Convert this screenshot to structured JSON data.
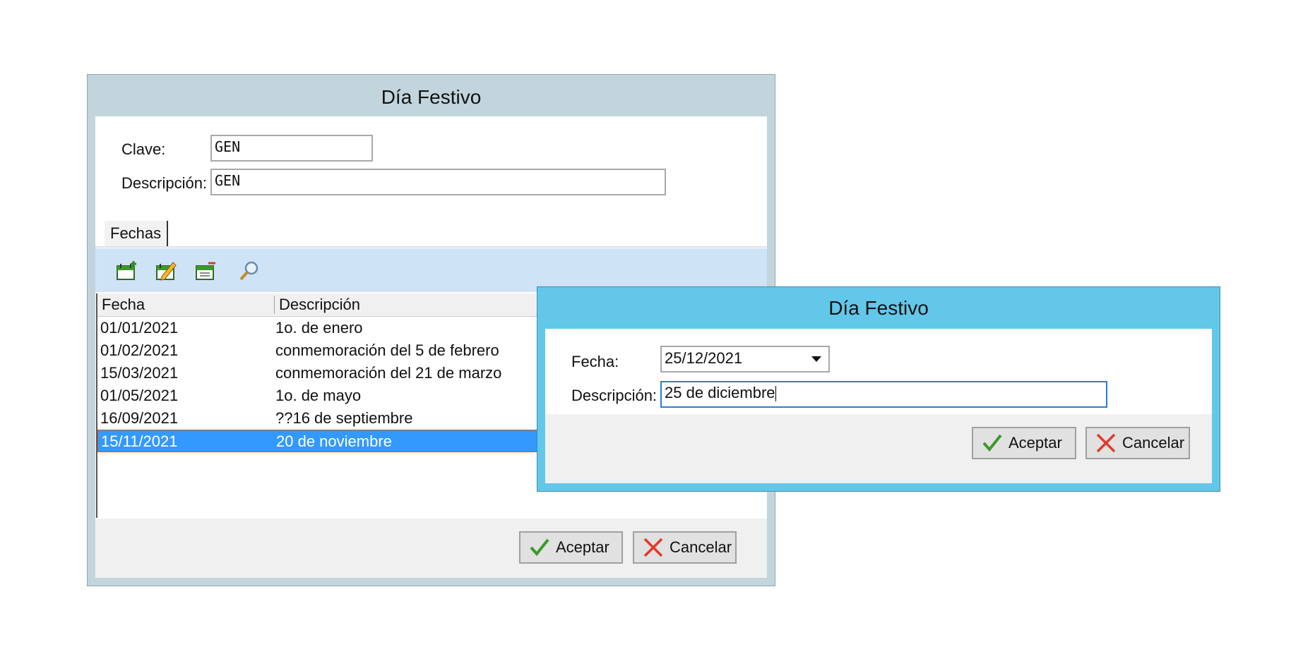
{
  "main_window": {
    "title": "Día Festivo",
    "clave_label": "Clave:",
    "clave_value": "GEN",
    "descripcion_label": "Descripción:",
    "descripcion_value": "GEN",
    "tab_label": "Fechas",
    "toolbar_icons": [
      "add-calendar-icon",
      "edit-calendar-icon",
      "delete-calendar-icon",
      "search-icon"
    ],
    "grid": {
      "columns": [
        "Fecha",
        "Descripción"
      ],
      "rows": [
        {
          "fecha": "01/01/2021",
          "descripcion": "1o. de enero"
        },
        {
          "fecha": "01/02/2021",
          "descripcion": "conmemoración del 5 de febrero"
        },
        {
          "fecha": "15/03/2021",
          "descripcion": "conmemoración del 21 de marzo"
        },
        {
          "fecha": "01/05/2021",
          "descripcion": "1o. de mayo"
        },
        {
          "fecha": "16/09/2021",
          "descripcion": "??16 de septiembre"
        },
        {
          "fecha": "15/11/2021",
          "descripcion": "20 de noviembre"
        }
      ],
      "selected_row": 5
    },
    "accept_label": "Aceptar",
    "cancel_label": "Cancelar"
  },
  "dialog": {
    "title": "Día Festivo",
    "fecha_label": "Fecha:",
    "fecha_value": "25/12/2021",
    "descripcion_label": "Descripción:",
    "descripcion_value": "25 de diciembre",
    "accept_label": "Aceptar",
    "cancel_label": "Cancelar"
  },
  "colors": {
    "main_title_bar": "#c2d5dc",
    "dialog_title_bar": "#63c7ea",
    "toolbar_bg": "#cfe3f7",
    "selection": "#3399ff"
  }
}
